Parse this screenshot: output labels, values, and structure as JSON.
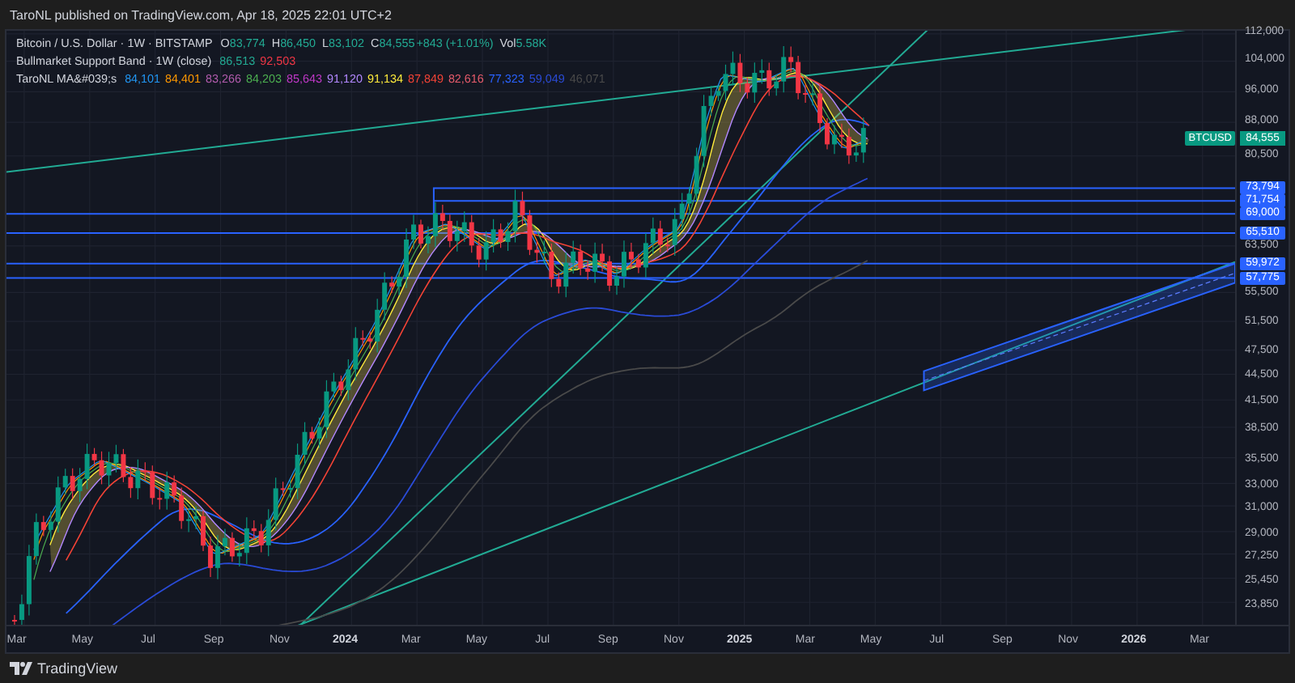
{
  "publisher_line": "TaroNL published on TradingView.com, Apr 18, 2025 22:01 UTC+2",
  "legend": {
    "symbol": {
      "title": "Bitcoin / U.S. Dollar · 1W · BITSTAMP",
      "fields": [
        {
          "label": "O",
          "value": "83,774"
        },
        {
          "label": "H",
          "value": "86,450"
        },
        {
          "label": "L",
          "value": "83,102"
        },
        {
          "label": "C",
          "value": "84,555"
        }
      ],
      "change": "+843 (+1.01%)",
      "volume": {
        "label": "Vol",
        "value": "5.58K"
      }
    },
    "indicators": [
      {
        "title": "Bullmarket Support Band · 1W (close)",
        "values": [
          {
            "text": "86,513",
            "color": "#22ab94"
          },
          {
            "text": "92,503",
            "color": "#f23645"
          }
        ]
      },
      {
        "title": "TaroNL MA&#039;s",
        "values": [
          {
            "text": "84,101",
            "color": "#2196f3"
          },
          {
            "text": "84,401",
            "color": "#ff9800"
          },
          {
            "text": "83,266",
            "color": "#b35cae"
          },
          {
            "text": "84,203",
            "color": "#4caf50"
          },
          {
            "text": "85,643",
            "color": "#c038c8"
          },
          {
            "text": "91,120",
            "color": "#b388ff"
          },
          {
            "text": "91,134",
            "color": "#ffeb3b"
          },
          {
            "text": "87,849",
            "color": "#f44336"
          },
          {
            "text": "82,616",
            "color": "#e75b6b"
          },
          {
            "text": "77,323",
            "color": "#2962ff"
          },
          {
            "text": "59,049",
            "color": "#2a4bd7"
          },
          {
            "text": "46,071",
            "color": "#4a4a4a"
          }
        ]
      }
    ]
  },
  "price_axis": [
    {
      "kind": "tick",
      "label": "112,000"
    },
    {
      "kind": "tick",
      "label": "104,000"
    },
    {
      "kind": "tick",
      "label": "96,000"
    },
    {
      "kind": "tick",
      "label": "88,000"
    },
    {
      "kind": "symbol",
      "symbol": "BTCUSD",
      "label": "84,555"
    },
    {
      "kind": "tick",
      "label": "80,500"
    },
    {
      "kind": "level",
      "label": "73,794"
    },
    {
      "kind": "level",
      "label": "71,754"
    },
    {
      "kind": "level",
      "label": "69,000"
    },
    {
      "kind": "level",
      "label": "65,510"
    },
    {
      "kind": "tick",
      "label": "63,500"
    },
    {
      "kind": "level",
      "label": "59,972"
    },
    {
      "kind": "level",
      "label": "57,775"
    },
    {
      "kind": "tick",
      "label": "55,500"
    },
    {
      "kind": "tick",
      "label": "51,500"
    },
    {
      "kind": "tick",
      "label": "47,500"
    },
    {
      "kind": "tick",
      "label": "44,500"
    },
    {
      "kind": "tick",
      "label": "41,500"
    },
    {
      "kind": "tick",
      "label": "38,500"
    },
    {
      "kind": "tick",
      "label": "35,500"
    },
    {
      "kind": "tick",
      "label": "33,000"
    },
    {
      "kind": "tick",
      "label": "31,000"
    },
    {
      "kind": "tick",
      "label": "29,000"
    },
    {
      "kind": "tick",
      "label": "27,250"
    },
    {
      "kind": "tick",
      "label": "25,450"
    },
    {
      "kind": "tick",
      "label": "23,850"
    }
  ],
  "time_axis": [
    {
      "kind": "month",
      "label": "Mar"
    },
    {
      "kind": "month",
      "label": "May"
    },
    {
      "kind": "month",
      "label": "Jul"
    },
    {
      "kind": "month",
      "label": "Sep"
    },
    {
      "kind": "month",
      "label": "Nov"
    },
    {
      "kind": "year",
      "label": "2024"
    },
    {
      "kind": "month",
      "label": "Mar"
    },
    {
      "kind": "month",
      "label": "May"
    },
    {
      "kind": "month",
      "label": "Jul"
    },
    {
      "kind": "month",
      "label": "Sep"
    },
    {
      "kind": "month",
      "label": "Nov"
    },
    {
      "kind": "year",
      "label": "2025"
    },
    {
      "kind": "month",
      "label": "Mar"
    },
    {
      "kind": "month",
      "label": "May"
    },
    {
      "kind": "month",
      "label": "Jul"
    },
    {
      "kind": "month",
      "label": "Sep"
    },
    {
      "kind": "month",
      "label": "Nov"
    },
    {
      "kind": "year",
      "label": "2026"
    },
    {
      "kind": "month",
      "label": "Mar"
    }
  ],
  "footer": {
    "brand": "TradingView"
  }
}
